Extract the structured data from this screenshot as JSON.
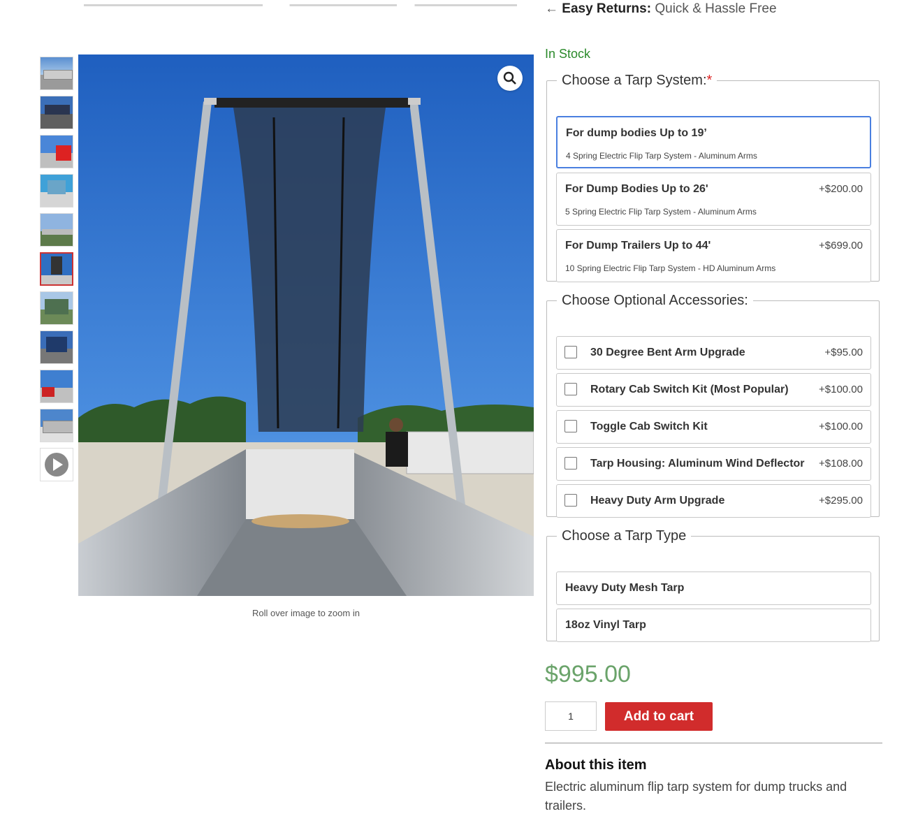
{
  "top_bar": {
    "arrow": "←",
    "returns_bold": "Easy Returns:",
    "returns_text": "Quick & Hassle Free"
  },
  "gallery": {
    "thumb_count": 11,
    "active_index": 5,
    "caption": "Roll over image to zoom in"
  },
  "stock_status": "In Stock",
  "tarp_system": {
    "legend": "Choose a Tarp System:",
    "required_mark": "*",
    "options": [
      {
        "name": "For dump bodies Up to 19’",
        "desc": "4 Spring Electric Flip Tarp System - Aluminum Arms",
        "price": ""
      },
      {
        "name": "For Dump Bodies Up to 26'",
        "desc": "5 Spring Electric Flip Tarp System - Aluminum Arms",
        "price": "+$200.00"
      },
      {
        "name": "For Dump Trailers Up to 44'",
        "desc": "10 Spring Electric Flip Tarp System - HD Aluminum Arms",
        "price": "+$699.00"
      }
    ]
  },
  "accessories": {
    "legend": "Choose Optional  Accessories:",
    "options": [
      {
        "name": "30 Degree Bent Arm Upgrade",
        "price": "+$95.00"
      },
      {
        "name": "Rotary Cab Switch Kit (Most Popular)",
        "price": "+$100.00"
      },
      {
        "name": "Toggle Cab Switch Kit",
        "price": "+$100.00"
      },
      {
        "name": "Tarp Housing: Aluminum Wind Deflector",
        "price": "+$108.00"
      },
      {
        "name": "Heavy Duty Arm Upgrade",
        "price": "+$295.00"
      }
    ]
  },
  "tarp_type": {
    "legend": "Choose a Tarp Type",
    "options": [
      {
        "name": "Heavy Duty Mesh Tarp"
      },
      {
        "name": "18oz Vinyl Tarp"
      }
    ]
  },
  "price": "$995.00",
  "quantity": "1",
  "add_to_cart": "Add to cart",
  "about": {
    "heading": "About this item",
    "text": "Electric aluminum flip tarp system for dump trucks and trailers."
  },
  "colors": {
    "accent_red": "#d12c2c",
    "stock_green": "#2b8a2b",
    "price_green": "#6aa36a",
    "selected_border": "#4a7fe0"
  }
}
